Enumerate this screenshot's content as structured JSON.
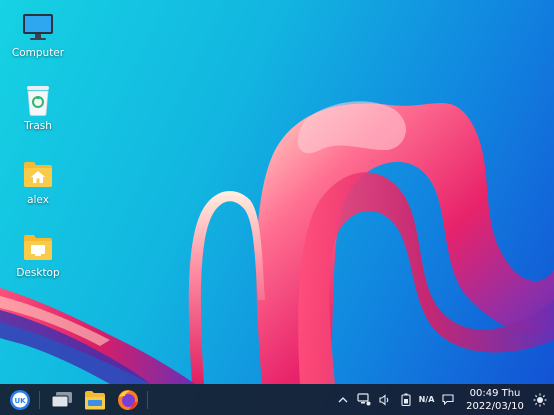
{
  "desktop": {
    "icons": [
      {
        "label": "Computer",
        "icon": "computer-icon"
      },
      {
        "label": "Trash",
        "icon": "trash-icon"
      },
      {
        "label": "alex",
        "icon": "home-folder-icon"
      },
      {
        "label": "Desktop",
        "icon": "desktop-folder-icon"
      }
    ]
  },
  "taskbar": {
    "start_label": "UK",
    "apps": [
      {
        "icon": "multitask-view-icon"
      },
      {
        "icon": "file-manager-icon"
      },
      {
        "icon": "firefox-icon"
      }
    ],
    "tray": {
      "network_status": "N/A"
    },
    "clock": {
      "time": "00:49 Thu",
      "date": "2022/03/10"
    }
  },
  "colors": {
    "taskbar_bg": "#161e30",
    "wallpaper_start": "#16d2e3",
    "wallpaper_end": "#134fd4",
    "ribbon_pink": "#f0346f",
    "folder_yellow": "#f5b932"
  }
}
